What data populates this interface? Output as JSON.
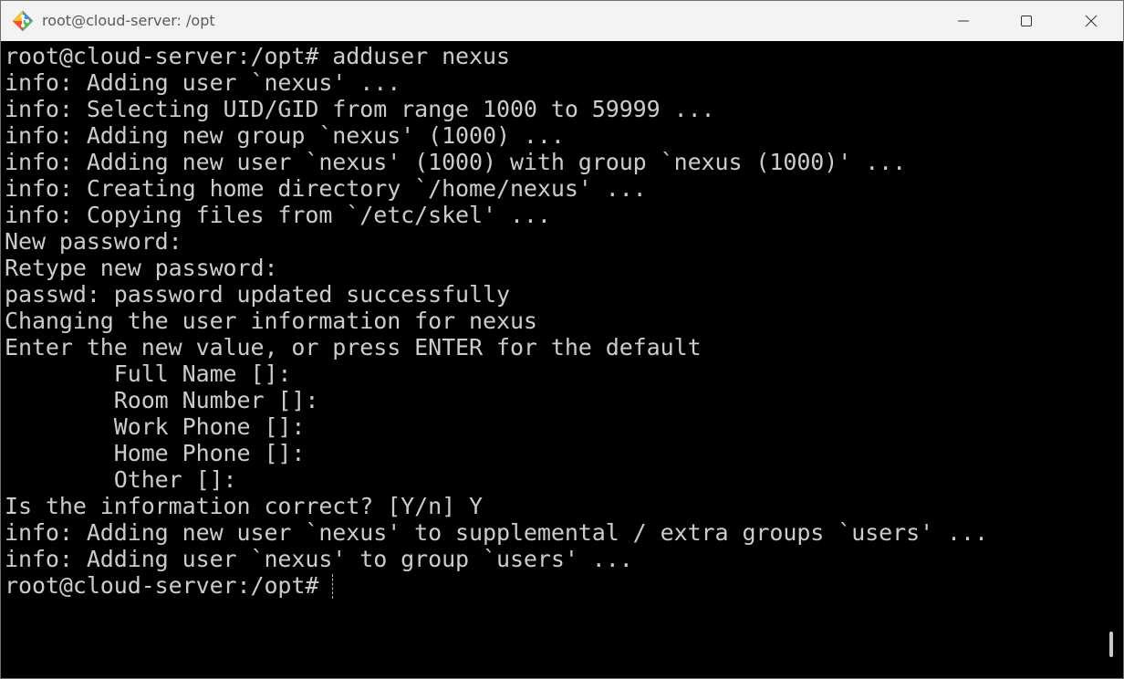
{
  "window": {
    "title": "root@cloud-server: /opt",
    "app_icon": "git-bash-diamond-icon",
    "controls": {
      "minimize_icon": "minimize-icon",
      "maximize_icon": "maximize-icon",
      "close_icon": "close-icon"
    }
  },
  "terminal": {
    "background": "#000000",
    "foreground": "#cccccc",
    "lines": [
      "root@cloud-server:/opt# adduser nexus",
      "info: Adding user `nexus' ...",
      "info: Selecting UID/GID from range 1000 to 59999 ...",
      "info: Adding new group `nexus' (1000) ...",
      "info: Adding new user `nexus' (1000) with group `nexus (1000)' ...",
      "info: Creating home directory `/home/nexus' ...",
      "info: Copying files from `/etc/skel' ...",
      "New password:",
      "Retype new password:",
      "passwd: password updated successfully",
      "Changing the user information for nexus",
      "Enter the new value, or press ENTER for the default",
      "        Full Name []:",
      "        Room Number []:",
      "        Work Phone []:",
      "        Home Phone []:",
      "        Other []:",
      "Is the information correct? [Y/n] Y",
      "info: Adding new user `nexus' to supplemental / extra groups `users' ...",
      "info: Adding user `nexus' to group `users' ...",
      "root@cloud-server:/opt#"
    ]
  }
}
